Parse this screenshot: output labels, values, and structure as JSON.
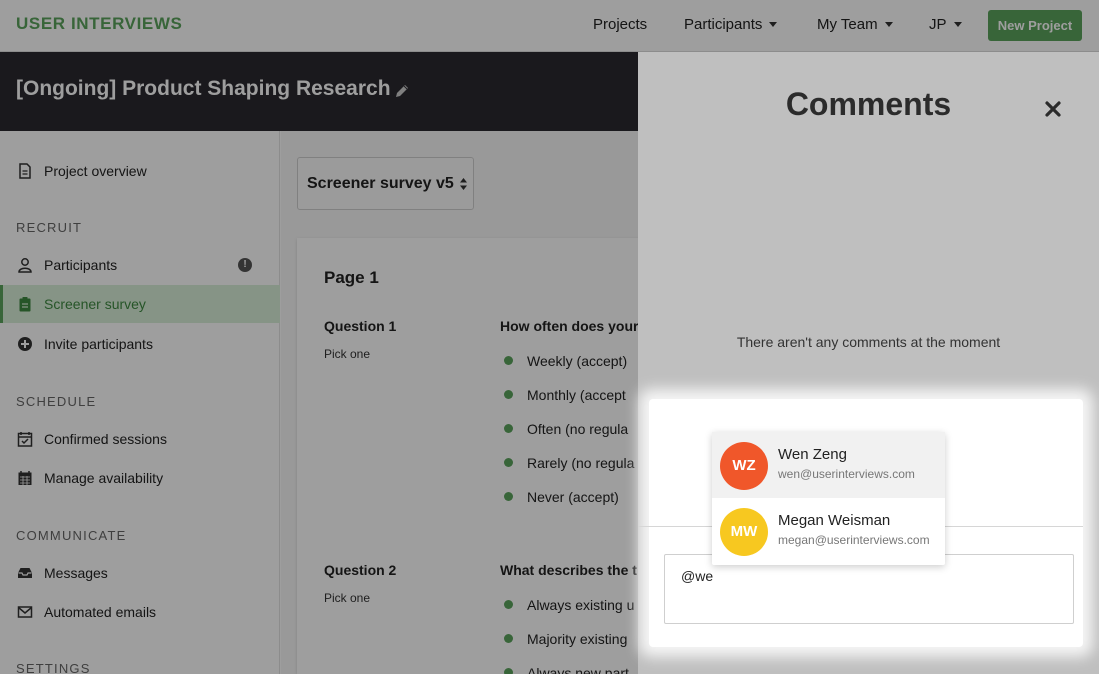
{
  "nav": {
    "logo": "USER INTERVIEWS",
    "projects": "Projects",
    "participants": "Participants",
    "my_team": "My Team",
    "user": "JP",
    "new_project": "New Project",
    "brand_color": "#5ba35d"
  },
  "project": {
    "title": "[Ongoing] Product Shaping Research"
  },
  "sidebar": {
    "overview": "Project overview",
    "recruit_heading": "RECRUIT",
    "participants": "Participants",
    "screener": "Screener survey",
    "invite": "Invite participants",
    "schedule_heading": "SCHEDULE",
    "confirmed": "Confirmed sessions",
    "availability": "Manage availability",
    "communicate_heading": "COMMUNICATE",
    "messages": "Messages",
    "automated": "Automated emails",
    "settings_heading": "SETTINGS"
  },
  "survey": {
    "selector_value": "Screener survey v5",
    "page_title": "Page 1",
    "questions": [
      {
        "label": "Question 1",
        "type": "Pick one",
        "text": "How often does your",
        "options": [
          "Weekly (accept)",
          "Monthly (accept",
          "Often (no regula",
          "Rarely (no regula",
          "Never (accept)"
        ]
      },
      {
        "label": "Question 2",
        "type": "Pick one",
        "text": "What describes the t",
        "options": [
          "Always existing u",
          "Majority existing",
          "Always new part"
        ]
      }
    ]
  },
  "comments": {
    "title": "Comments",
    "empty_text": "There aren't any comments at the moment",
    "input_value": "@we",
    "mentions": [
      {
        "initials": "WZ",
        "name": "Wen Zeng",
        "email": "wen@userinterviews.com",
        "color": "#f0572a"
      },
      {
        "initials": "MW",
        "name": "Megan Weisman",
        "email": "megan@userinterviews.com",
        "color": "#f7c820"
      }
    ]
  }
}
